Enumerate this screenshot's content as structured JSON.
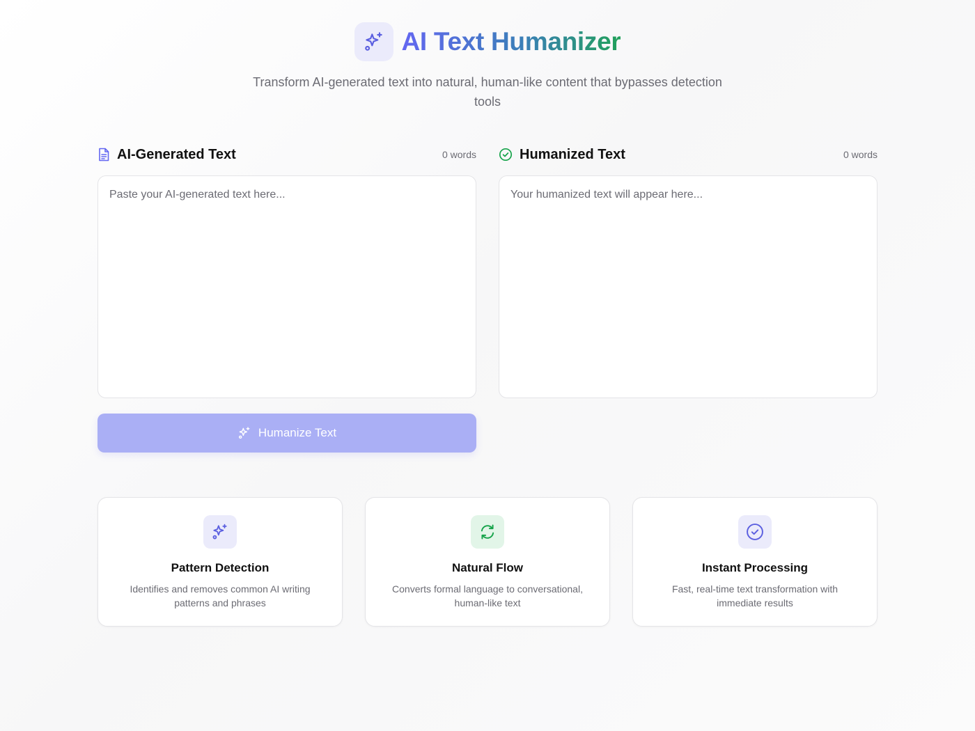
{
  "header": {
    "title": "AI Text Humanizer",
    "subtitle": "Transform AI-generated text into natural, human-like content that bypasses detection tools",
    "logo_icon": "sparkles-icon"
  },
  "input_panel": {
    "title": "AI-Generated Text",
    "icon": "document-icon",
    "word_count": "0 words",
    "placeholder": "Paste your AI-generated text here..."
  },
  "output_panel": {
    "title": "Humanized Text",
    "icon": "check-circle-icon",
    "word_count": "0 words",
    "placeholder": "Your humanized text will appear here..."
  },
  "action": {
    "button_label": "Humanize Text",
    "icon": "sparkles-icon"
  },
  "features": [
    {
      "title": "Pattern Detection",
      "description": "Identifies and removes common AI writing patterns and phrases",
      "icon": "sparkles-icon"
    },
    {
      "title": "Natural Flow",
      "description": "Converts formal language to conversational, human-like text",
      "icon": "refresh-icon"
    },
    {
      "title": "Instant Processing",
      "description": "Fast, real-time text transformation with immediate results",
      "icon": "check-circle-icon"
    }
  ],
  "colors": {
    "accent": "#6366f1",
    "success": "#16a34a",
    "button_disabled": "#aaaff5",
    "muted_text": "#6b6b73"
  }
}
